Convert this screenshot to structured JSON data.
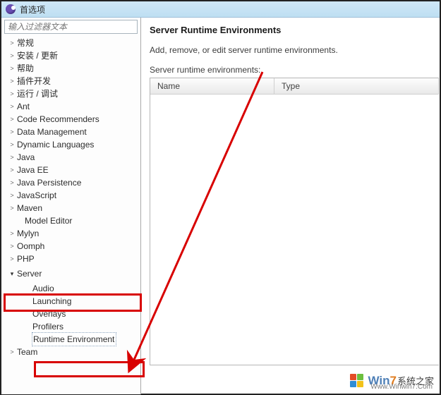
{
  "window": {
    "title": "首选项"
  },
  "filter": {
    "placeholder": "输入过滤器文本"
  },
  "tree": {
    "items": [
      {
        "label": "常规",
        "toggle": ">"
      },
      {
        "label": "安装 / 更新",
        "toggle": ">"
      },
      {
        "label": "帮助",
        "toggle": ">"
      },
      {
        "label": "插件开发",
        "toggle": ">"
      },
      {
        "label": "运行 / 调试",
        "toggle": ">"
      },
      {
        "label": "Ant",
        "toggle": ">"
      },
      {
        "label": "Code Recommenders",
        "toggle": ">"
      },
      {
        "label": "Data Management",
        "toggle": ">"
      },
      {
        "label": "Dynamic Languages",
        "toggle": ">"
      },
      {
        "label": "Java",
        "toggle": ">"
      },
      {
        "label": "Java EE",
        "toggle": ">"
      },
      {
        "label": "Java Persistence",
        "toggle": ">"
      },
      {
        "label": "JavaScript",
        "toggle": ">"
      },
      {
        "label": "Maven",
        "toggle": ">"
      },
      {
        "label": "Model Editor",
        "toggle": ""
      },
      {
        "label": "Mylyn",
        "toggle": ">"
      },
      {
        "label": "Oomph",
        "toggle": ">"
      },
      {
        "label": "PHP",
        "toggle": ">"
      },
      {
        "label": "Server",
        "toggle": "▾"
      },
      {
        "label": "Team",
        "toggle": ">"
      }
    ],
    "server_children": [
      {
        "label": "Audio"
      },
      {
        "label": "Launching"
      },
      {
        "label": "Overlays"
      },
      {
        "label": "Profilers"
      },
      {
        "label": "Runtime Environment"
      }
    ]
  },
  "main": {
    "title": "Server Runtime Environments",
    "description": "Add, remove, or edit server runtime environments.",
    "table_label": "Server runtime environments:",
    "columns": {
      "name": "Name",
      "type": "Type"
    }
  },
  "watermark": {
    "brand_a": "Win",
    "brand_b": "7",
    "brand_c": "系统之家",
    "url": "Www.Winwin7.Com"
  }
}
